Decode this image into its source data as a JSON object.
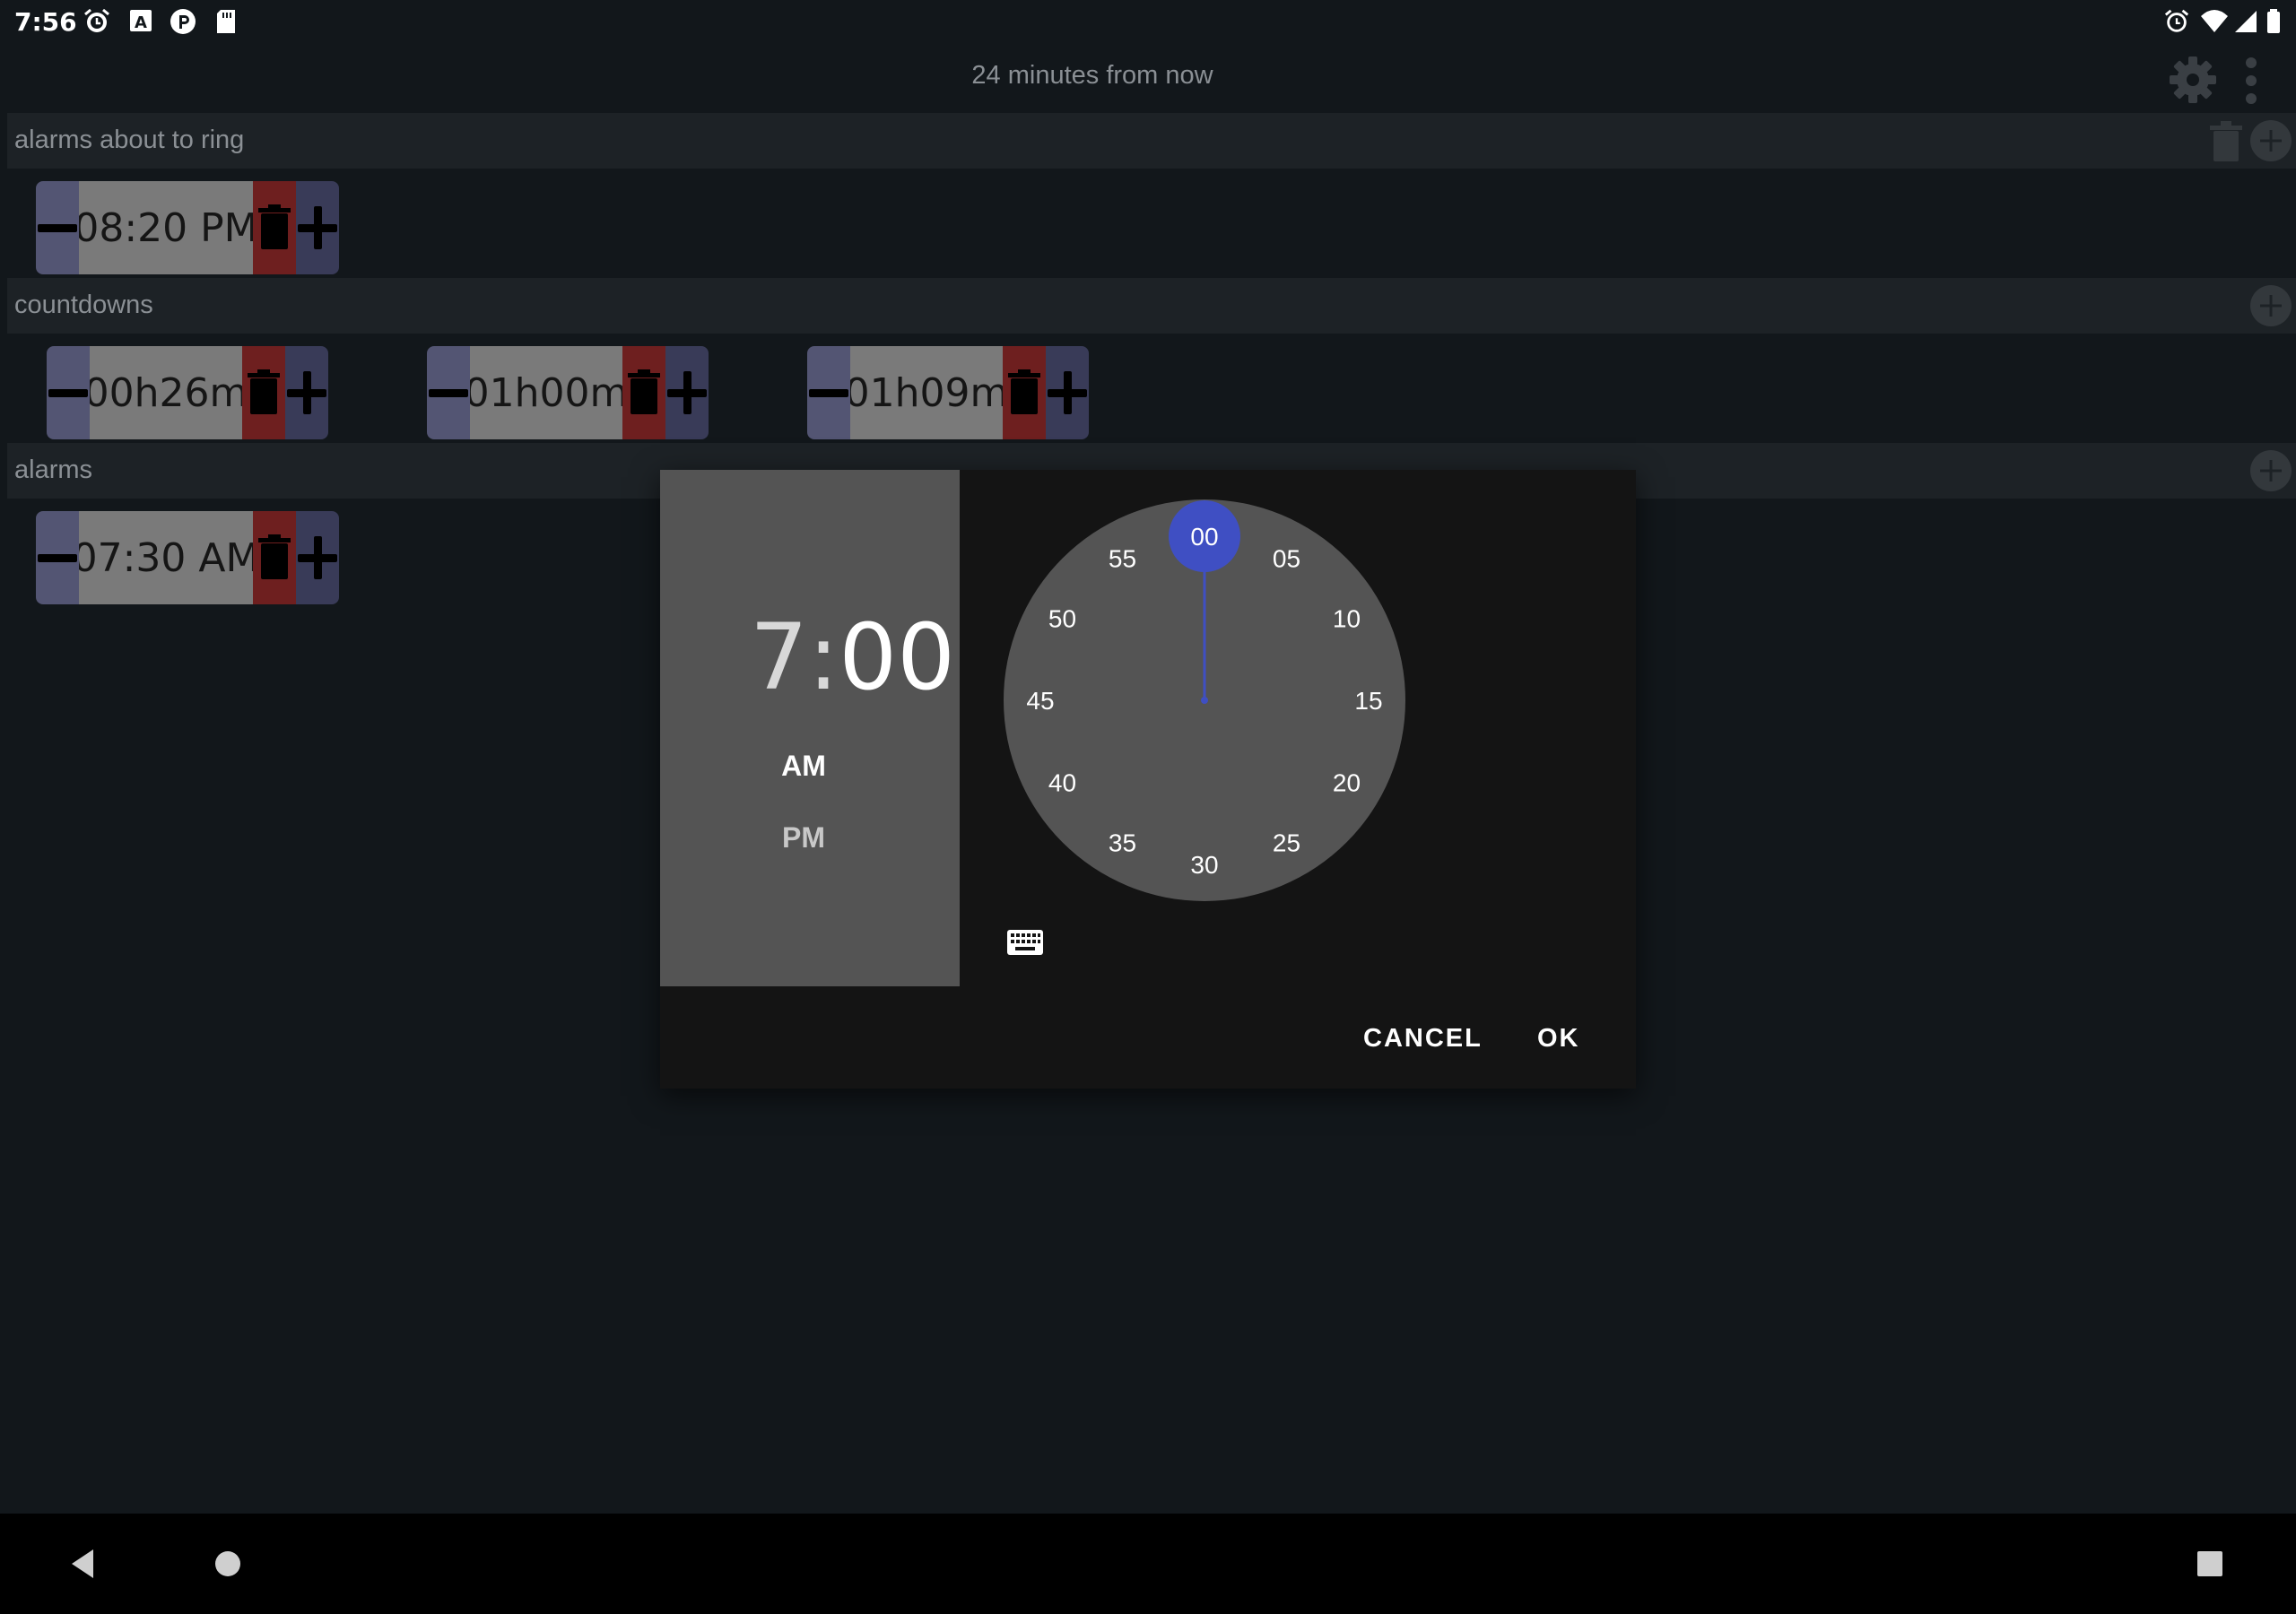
{
  "status_bar": {
    "time": "7:56"
  },
  "header": {
    "info_text": "24 minutes from now"
  },
  "sections": {
    "about_to_ring": {
      "label": "alarms about to ring"
    },
    "countdowns": {
      "label": "countdowns"
    },
    "alarms": {
      "label": "alarms"
    }
  },
  "chips": {
    "about_to_ring": [
      "08:20 PM"
    ],
    "countdowns": [
      "00h26m",
      "01h00m",
      "01h09m"
    ],
    "alarms": [
      "07:30 AM"
    ]
  },
  "dialog": {
    "hour": "7",
    "separator": ":",
    "minute": "00",
    "am_label": "AM",
    "pm_label": "PM",
    "selected_period": "AM",
    "clock_numbers": [
      "00",
      "05",
      "10",
      "15",
      "20",
      "25",
      "30",
      "35",
      "40",
      "45",
      "50",
      "55"
    ],
    "selected_minute": "00",
    "cancel_label": "CANCEL",
    "ok_label": "OK"
  },
  "colors": {
    "accent": "#3f4fc3",
    "chip_minus": "#535573",
    "chip_value": "#7a7a7a",
    "chip_trash": "#6e1f1f",
    "chip_plus": "#393b58"
  }
}
